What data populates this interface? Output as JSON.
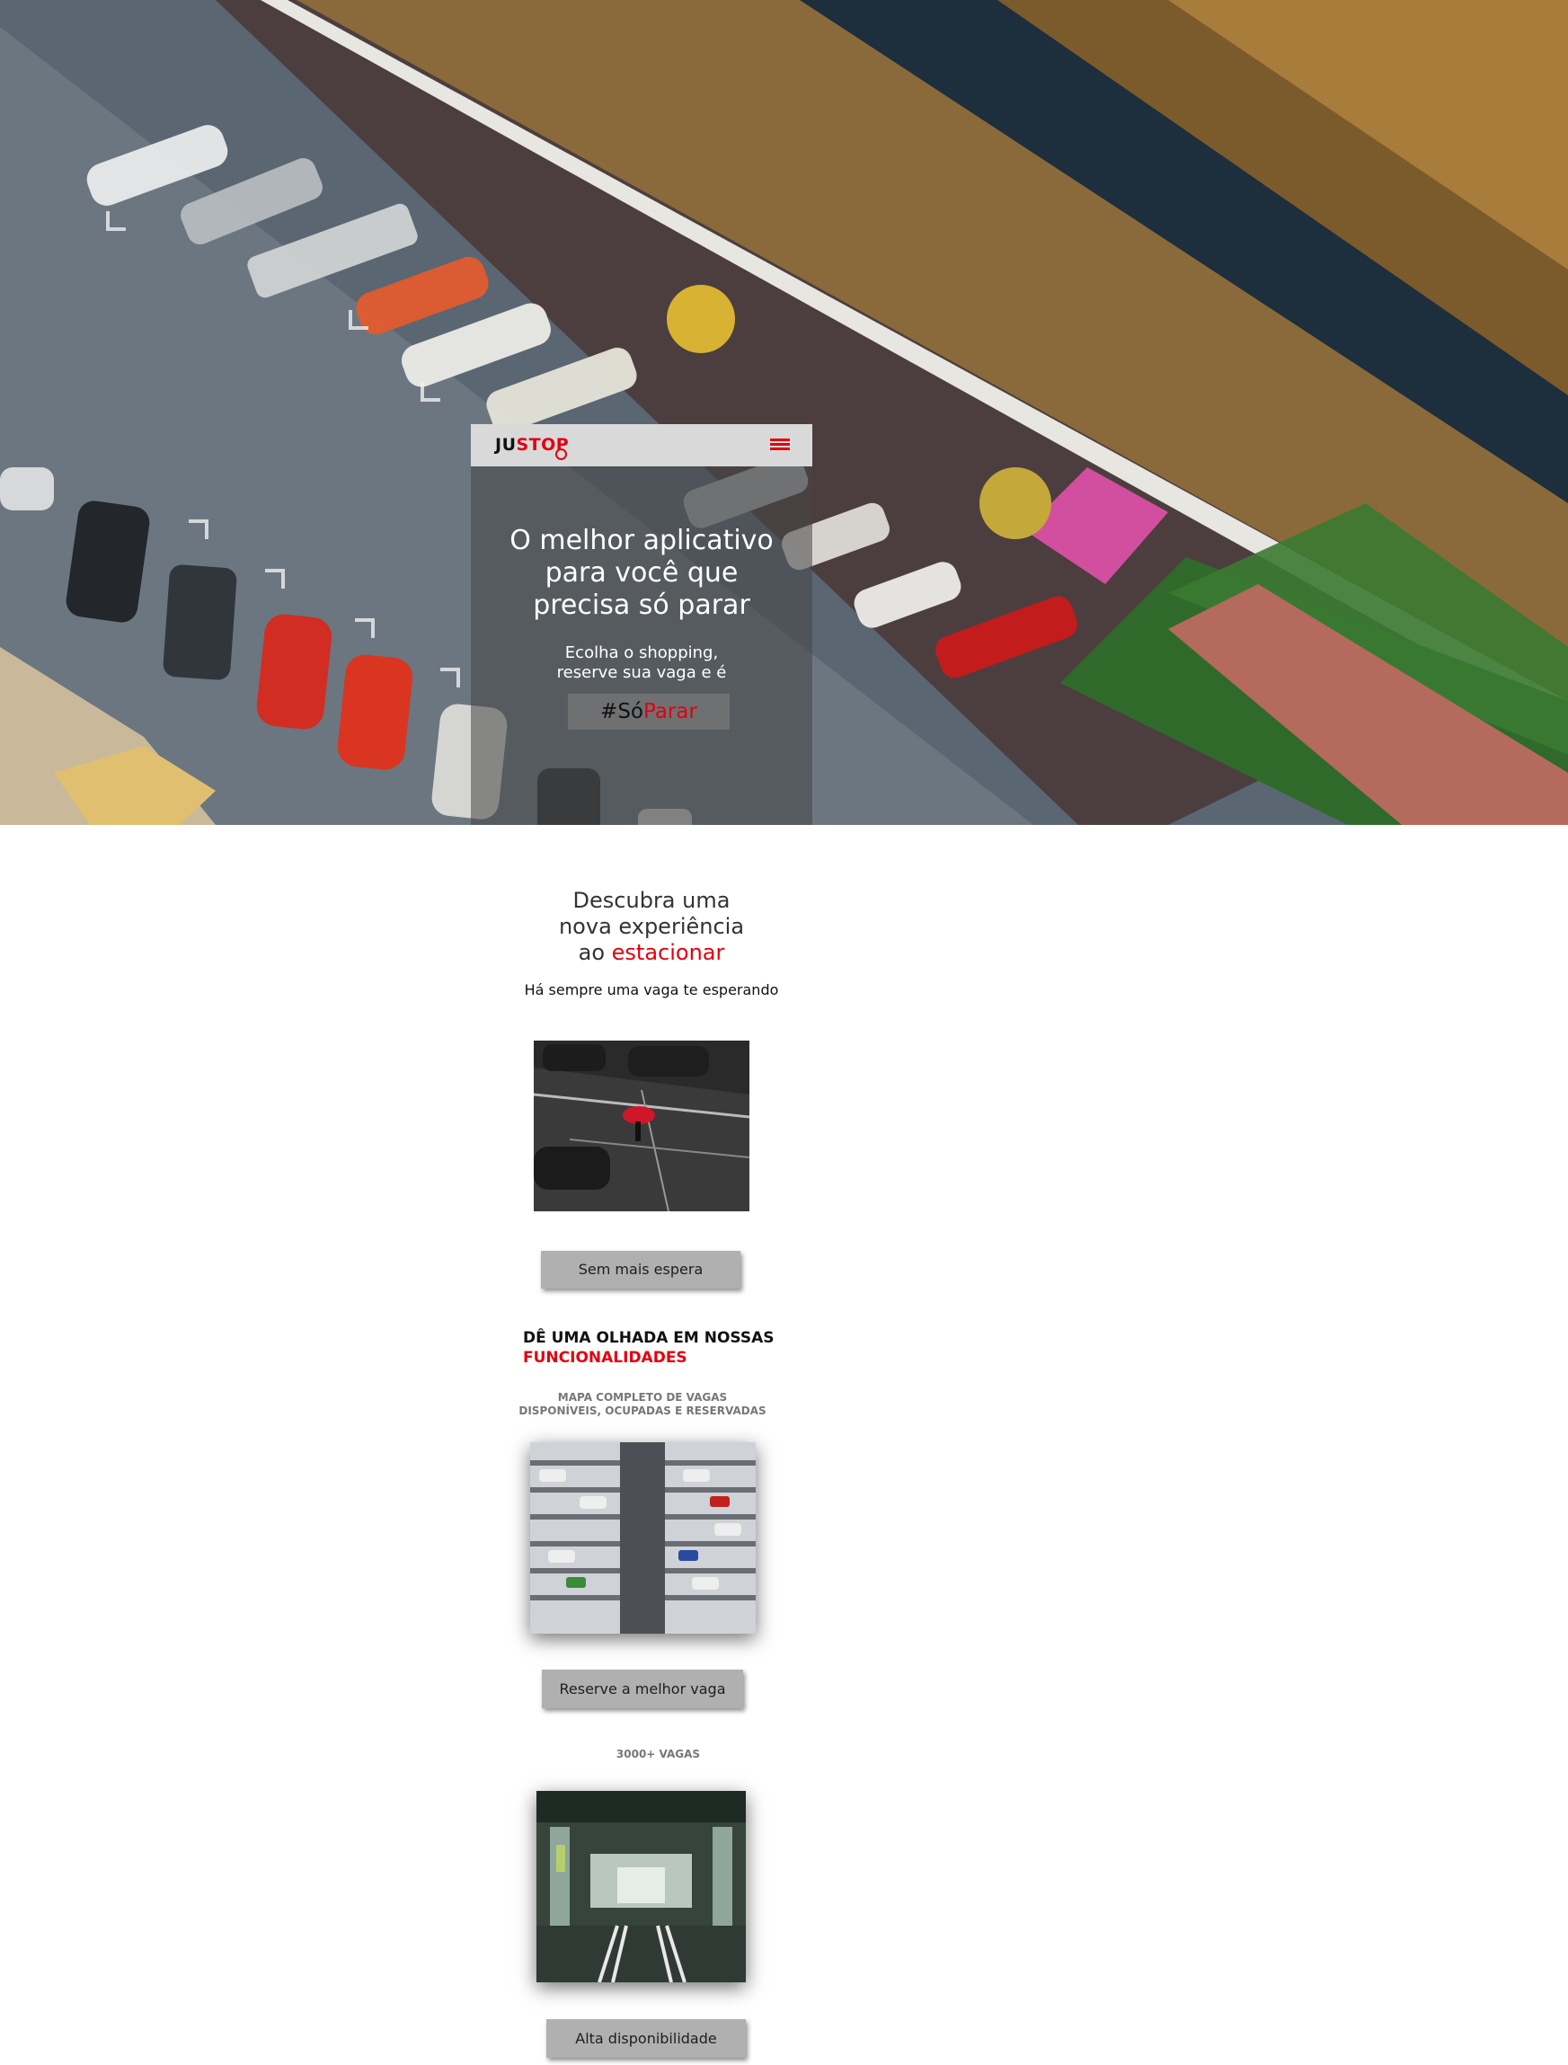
{
  "header": {
    "logo_ju": "JU",
    "logo_stop": "STOP"
  },
  "hero": {
    "title_line1": "O melhor aplicativo",
    "title_line2": "para você que",
    "title_line3": "precisa só parar",
    "subtitle_line1": "Ecolha o shopping,",
    "subtitle_line2": "reserve sua vaga e é",
    "tag_hash": "#Só",
    "tag_parar": "Parar"
  },
  "discover": {
    "line1": "Descubra uma",
    "line2": "nova experiência",
    "line3_prefix": "ao ",
    "line3_highlight": "estacionar",
    "subtitle": "Há sempre uma vaga te esperando",
    "button_label": "Sem mais espera"
  },
  "features": {
    "title_line1": "DÊ UMA OLHADA EM NOSSAS",
    "title_line2": "FUNCIONALIDADES",
    "map_caption_line1": "MAPA COMPLETO DE VAGAS",
    "map_caption_line2": "DISPONÍVEIS, OCUPADAS E RESERVADAS",
    "reserve_button": "Reserve a melhor vaga",
    "spots_caption": "3000+ VAGAS",
    "availability_button": "Alta disponibilidade"
  },
  "colors": {
    "accent_red": "#e3000f",
    "button_gray": "#b0b0b0",
    "header_gray": "#d9d9d9"
  },
  "icons": [
    "menu-icon",
    "logo-mark-icon"
  ]
}
